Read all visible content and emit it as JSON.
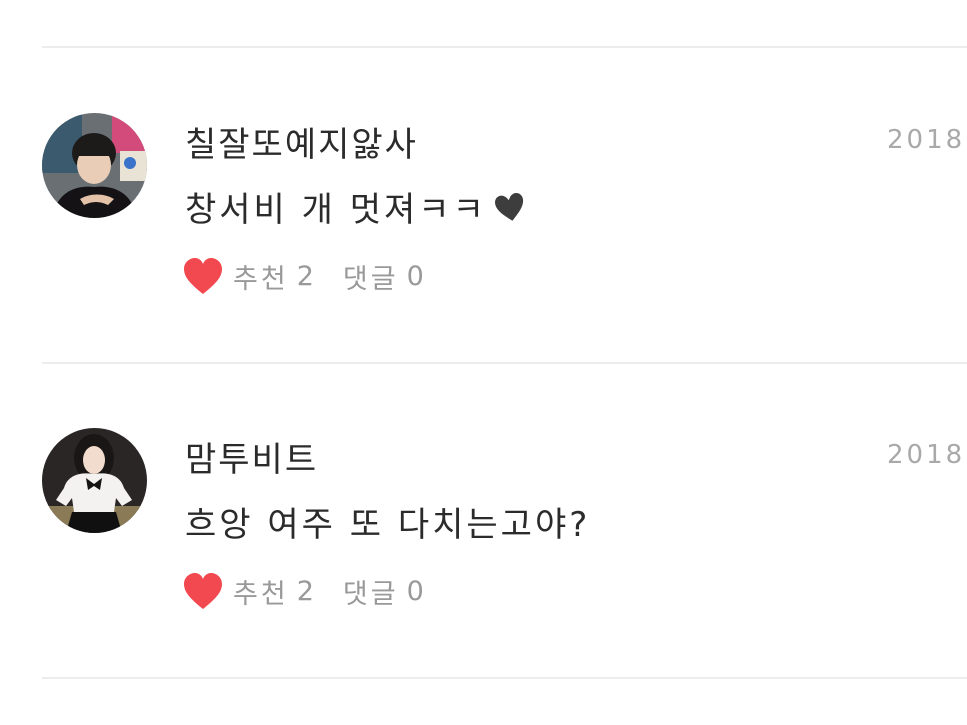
{
  "comments": [
    {
      "author": "칠잘또예지앓사",
      "date": "2018.0",
      "text": "창서비 개 멋져ㅋㅋ",
      "text_emoji": "dark-heart-icon",
      "like_label": "추천",
      "like_count": "2",
      "reply_label": "댓글",
      "reply_count": "0"
    },
    {
      "author": "맘투비트",
      "date": "2018.0",
      "text": "흐앙 여주 또 다치는고야?",
      "like_label": "추천",
      "like_count": "2",
      "reply_label": "댓글",
      "reply_count": "0"
    }
  ],
  "colors": {
    "like_heart": "#f2484f",
    "divider": "#ececec",
    "muted_text": "#999999",
    "date_text": "#a9a9a9",
    "primary_text": "#2b2b2b"
  }
}
